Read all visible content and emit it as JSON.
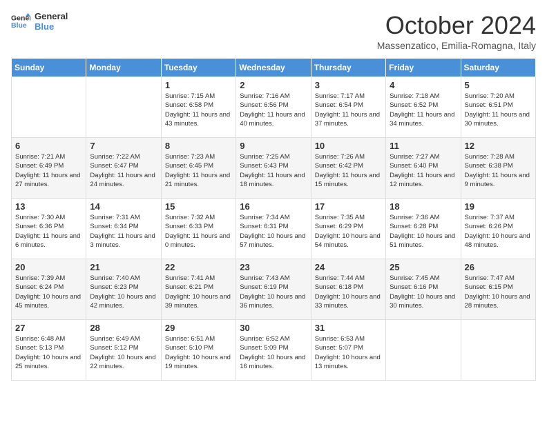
{
  "header": {
    "logo_line1": "General",
    "logo_line2": "Blue",
    "month_year": "October 2024",
    "location": "Massenzatico, Emilia-Romagna, Italy"
  },
  "weekdays": [
    "Sunday",
    "Monday",
    "Tuesday",
    "Wednesday",
    "Thursday",
    "Friday",
    "Saturday"
  ],
  "weeks": [
    [
      {
        "day": "",
        "info": ""
      },
      {
        "day": "",
        "info": ""
      },
      {
        "day": "1",
        "info": "Sunrise: 7:15 AM\nSunset: 6:58 PM\nDaylight: 11 hours and 43 minutes."
      },
      {
        "day": "2",
        "info": "Sunrise: 7:16 AM\nSunset: 6:56 PM\nDaylight: 11 hours and 40 minutes."
      },
      {
        "day": "3",
        "info": "Sunrise: 7:17 AM\nSunset: 6:54 PM\nDaylight: 11 hours and 37 minutes."
      },
      {
        "day": "4",
        "info": "Sunrise: 7:18 AM\nSunset: 6:52 PM\nDaylight: 11 hours and 34 minutes."
      },
      {
        "day": "5",
        "info": "Sunrise: 7:20 AM\nSunset: 6:51 PM\nDaylight: 11 hours and 30 minutes."
      }
    ],
    [
      {
        "day": "6",
        "info": "Sunrise: 7:21 AM\nSunset: 6:49 PM\nDaylight: 11 hours and 27 minutes."
      },
      {
        "day": "7",
        "info": "Sunrise: 7:22 AM\nSunset: 6:47 PM\nDaylight: 11 hours and 24 minutes."
      },
      {
        "day": "8",
        "info": "Sunrise: 7:23 AM\nSunset: 6:45 PM\nDaylight: 11 hours and 21 minutes."
      },
      {
        "day": "9",
        "info": "Sunrise: 7:25 AM\nSunset: 6:43 PM\nDaylight: 11 hours and 18 minutes."
      },
      {
        "day": "10",
        "info": "Sunrise: 7:26 AM\nSunset: 6:42 PM\nDaylight: 11 hours and 15 minutes."
      },
      {
        "day": "11",
        "info": "Sunrise: 7:27 AM\nSunset: 6:40 PM\nDaylight: 11 hours and 12 minutes."
      },
      {
        "day": "12",
        "info": "Sunrise: 7:28 AM\nSunset: 6:38 PM\nDaylight: 11 hours and 9 minutes."
      }
    ],
    [
      {
        "day": "13",
        "info": "Sunrise: 7:30 AM\nSunset: 6:36 PM\nDaylight: 11 hours and 6 minutes."
      },
      {
        "day": "14",
        "info": "Sunrise: 7:31 AM\nSunset: 6:34 PM\nDaylight: 11 hours and 3 minutes."
      },
      {
        "day": "15",
        "info": "Sunrise: 7:32 AM\nSunset: 6:33 PM\nDaylight: 11 hours and 0 minutes."
      },
      {
        "day": "16",
        "info": "Sunrise: 7:34 AM\nSunset: 6:31 PM\nDaylight: 10 hours and 57 minutes."
      },
      {
        "day": "17",
        "info": "Sunrise: 7:35 AM\nSunset: 6:29 PM\nDaylight: 10 hours and 54 minutes."
      },
      {
        "day": "18",
        "info": "Sunrise: 7:36 AM\nSunset: 6:28 PM\nDaylight: 10 hours and 51 minutes."
      },
      {
        "day": "19",
        "info": "Sunrise: 7:37 AM\nSunset: 6:26 PM\nDaylight: 10 hours and 48 minutes."
      }
    ],
    [
      {
        "day": "20",
        "info": "Sunrise: 7:39 AM\nSunset: 6:24 PM\nDaylight: 10 hours and 45 minutes."
      },
      {
        "day": "21",
        "info": "Sunrise: 7:40 AM\nSunset: 6:23 PM\nDaylight: 10 hours and 42 minutes."
      },
      {
        "day": "22",
        "info": "Sunrise: 7:41 AM\nSunset: 6:21 PM\nDaylight: 10 hours and 39 minutes."
      },
      {
        "day": "23",
        "info": "Sunrise: 7:43 AM\nSunset: 6:19 PM\nDaylight: 10 hours and 36 minutes."
      },
      {
        "day": "24",
        "info": "Sunrise: 7:44 AM\nSunset: 6:18 PM\nDaylight: 10 hours and 33 minutes."
      },
      {
        "day": "25",
        "info": "Sunrise: 7:45 AM\nSunset: 6:16 PM\nDaylight: 10 hours and 30 minutes."
      },
      {
        "day": "26",
        "info": "Sunrise: 7:47 AM\nSunset: 6:15 PM\nDaylight: 10 hours and 28 minutes."
      }
    ],
    [
      {
        "day": "27",
        "info": "Sunrise: 6:48 AM\nSunset: 5:13 PM\nDaylight: 10 hours and 25 minutes."
      },
      {
        "day": "28",
        "info": "Sunrise: 6:49 AM\nSunset: 5:12 PM\nDaylight: 10 hours and 22 minutes."
      },
      {
        "day": "29",
        "info": "Sunrise: 6:51 AM\nSunset: 5:10 PM\nDaylight: 10 hours and 19 minutes."
      },
      {
        "day": "30",
        "info": "Sunrise: 6:52 AM\nSunset: 5:09 PM\nDaylight: 10 hours and 16 minutes."
      },
      {
        "day": "31",
        "info": "Sunrise: 6:53 AM\nSunset: 5:07 PM\nDaylight: 10 hours and 13 minutes."
      },
      {
        "day": "",
        "info": ""
      },
      {
        "day": "",
        "info": ""
      }
    ]
  ]
}
